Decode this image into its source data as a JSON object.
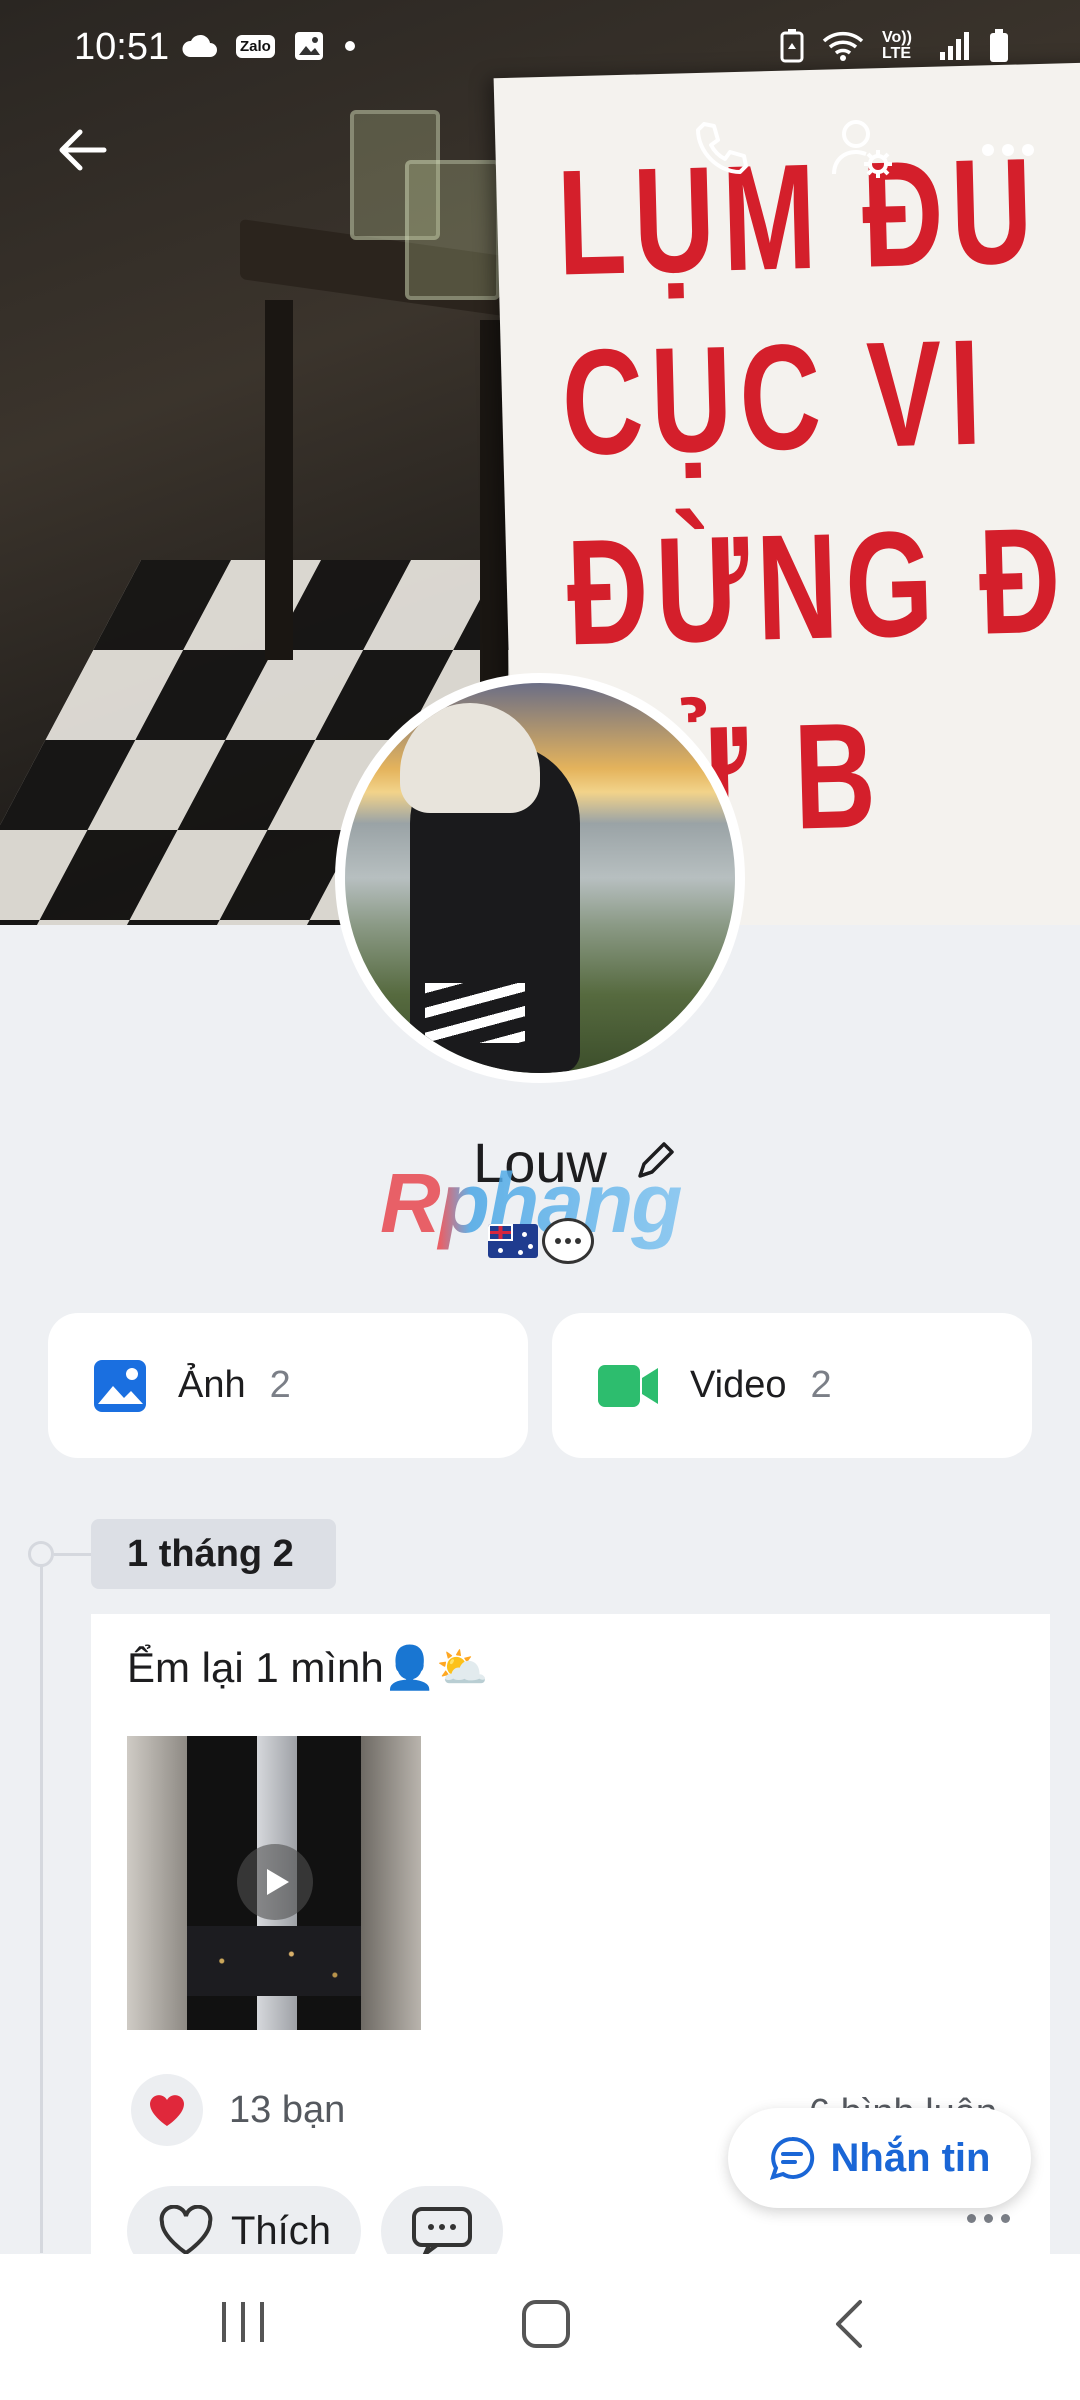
{
  "status_bar": {
    "time": "10:51",
    "left_icons": [
      "cloud-icon",
      "zalo-icon",
      "gallery-icon",
      "dot-icon"
    ],
    "zalo_label": "Zalo",
    "right_icons": [
      "battery-saver-icon",
      "wifi-icon",
      "volte-icon",
      "signal-icon",
      "battery-icon"
    ],
    "volte_label": "Vo)) LTE"
  },
  "cover": {
    "sign_lines": [
      "LỤM ĐU",
      "CỤC VI",
      "ĐỪNG Đ",
      "XỬ B"
    ]
  },
  "top_actions": {
    "icons": [
      "back-arrow-icon",
      "phone-icon",
      "user-settings-icon",
      "more-horizontal-icon"
    ]
  },
  "profile": {
    "name": "Louw",
    "watermark": "Rphang",
    "flag": "australia-flag",
    "status_icon": "speech-bubble-icon"
  },
  "media": {
    "photos_label": "Ảnh",
    "photos_count": "2",
    "videos_label": "Video",
    "videos_count": "2",
    "photos_color": "#1a6fe0",
    "videos_color": "#2dbd6e"
  },
  "timeline": {
    "date": "1 tháng 2"
  },
  "post": {
    "text": "Ểm lại 1 mình👤⛅",
    "reaction_count": "13 bạn",
    "comment_count": "6 bình luận",
    "like_label": "Thích"
  },
  "floating": {
    "message_label": "Nhắn tin",
    "accent": "#1a66d6"
  },
  "nav": {
    "icons": [
      "recent-apps-icon",
      "home-icon",
      "back-icon"
    ]
  }
}
